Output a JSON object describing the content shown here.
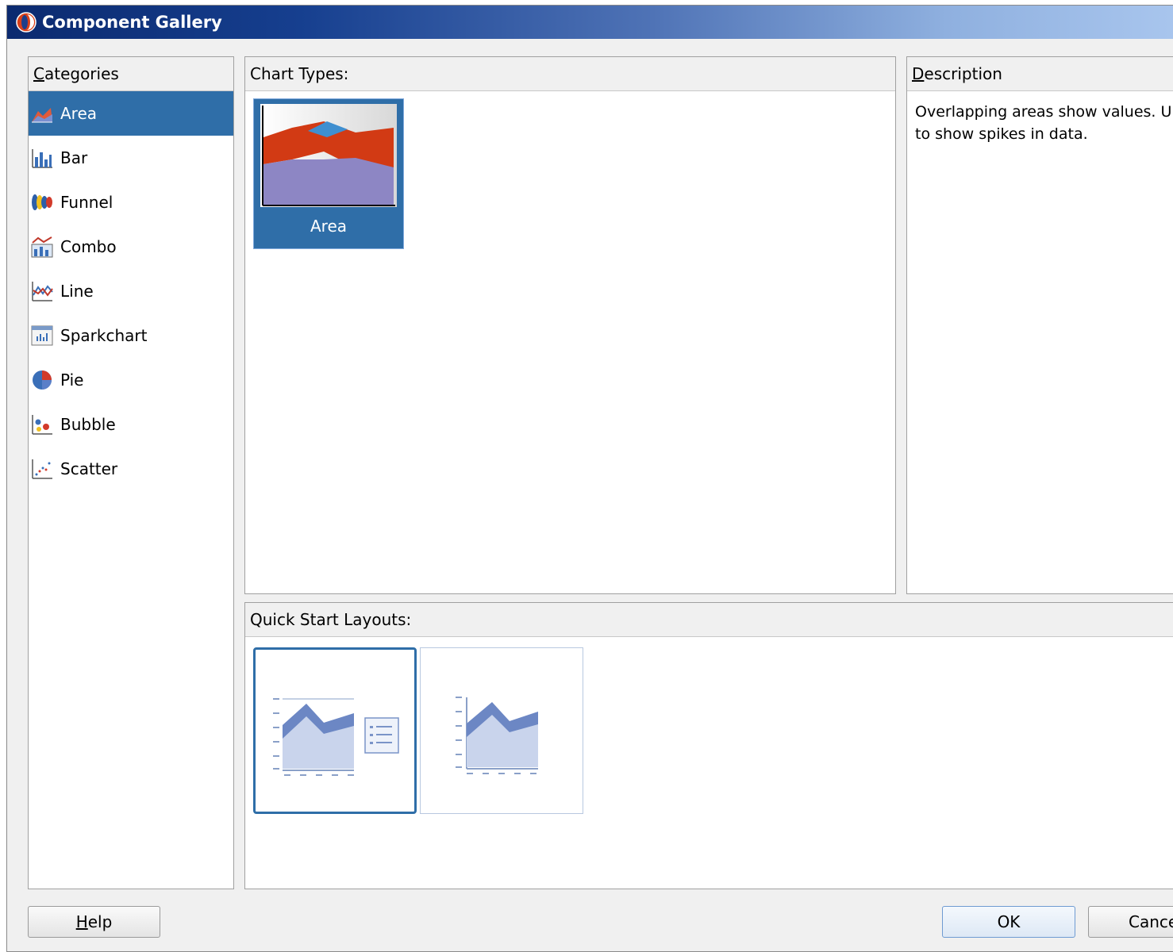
{
  "window": {
    "title": "Component Gallery"
  },
  "categories": {
    "header": "Categories",
    "items": [
      {
        "label": "Area",
        "icon": "area-chart-icon",
        "selected": true
      },
      {
        "label": "Bar",
        "icon": "bar-chart-icon"
      },
      {
        "label": "Funnel",
        "icon": "funnel-chart-icon"
      },
      {
        "label": "Combo",
        "icon": "combo-chart-icon"
      },
      {
        "label": "Line",
        "icon": "line-chart-icon"
      },
      {
        "label": "Sparkchart",
        "icon": "sparkchart-icon"
      },
      {
        "label": "Pie",
        "icon": "pie-chart-icon"
      },
      {
        "label": "Bubble",
        "icon": "bubble-chart-icon"
      },
      {
        "label": "Scatter",
        "icon": "scatter-chart-icon"
      }
    ]
  },
  "chart_types": {
    "header": "Chart Types:",
    "items": [
      {
        "label": "Area",
        "selected": true
      }
    ]
  },
  "description": {
    "header": "Description",
    "text_line1": "Overlapping areas show values. U",
    "text_line2": "to show spikes in data."
  },
  "quick_start": {
    "header": "Quick Start Layouts:",
    "layouts": [
      {
        "name": "chart-with-legend",
        "selected": true
      },
      {
        "name": "chart-only",
        "selected": false
      }
    ]
  },
  "buttons": {
    "help": "Help",
    "ok": "OK",
    "cancel": "Cance"
  },
  "colors": {
    "selection": "#2f6ea8",
    "title_bar_start": "#0b2a6f",
    "title_bar_end": "#a9c6ee"
  }
}
